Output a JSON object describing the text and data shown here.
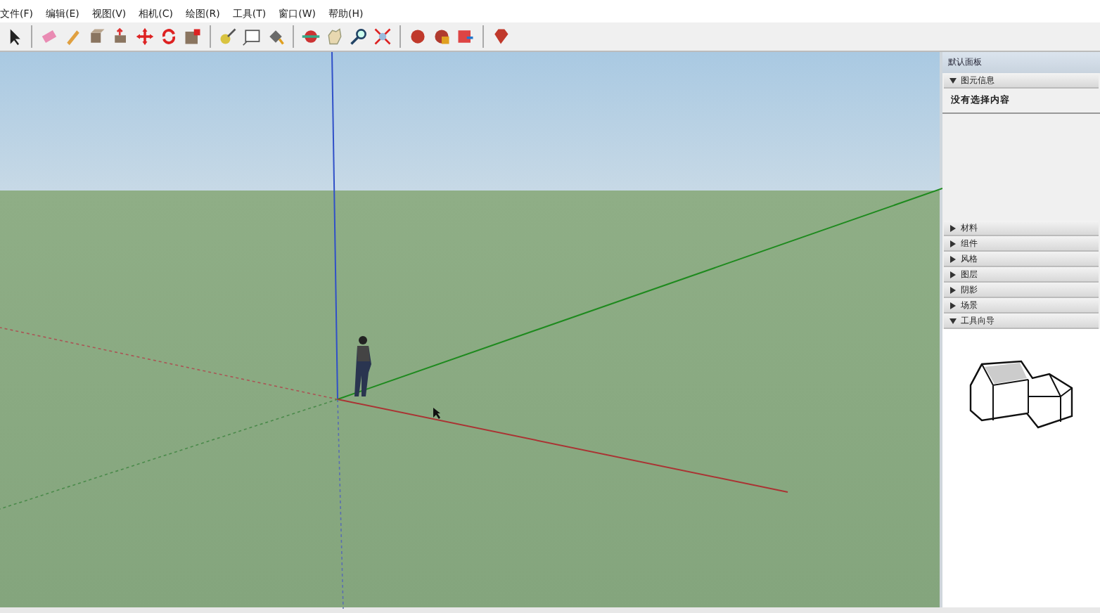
{
  "menu": [
    "文件(F)",
    "编辑(E)",
    "视图(V)",
    "相机(C)",
    "绘图(R)",
    "工具(T)",
    "窗口(W)",
    "帮助(H)"
  ],
  "tray": {
    "title": "默认面板",
    "sections": [
      {
        "label": "图元信息",
        "expanded": true,
        "content": "没有选择内容"
      },
      {
        "label": "材料",
        "expanded": false
      },
      {
        "label": "组件",
        "expanded": false
      },
      {
        "label": "风格",
        "expanded": false
      },
      {
        "label": "图层",
        "expanded": false
      },
      {
        "label": "阴影",
        "expanded": false
      },
      {
        "label": "场景",
        "expanded": false
      },
      {
        "label": "工具向导",
        "expanded": true
      }
    ]
  }
}
